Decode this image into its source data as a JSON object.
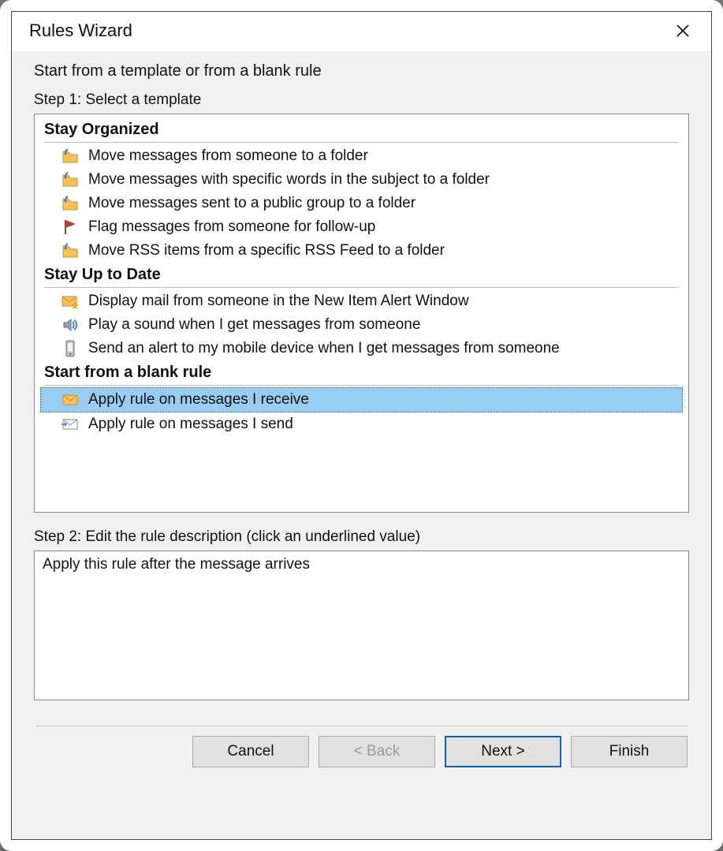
{
  "title": "Rules Wizard",
  "heading": "Start from a template or from a blank rule",
  "step1_label": "Step 1: Select a template",
  "groups": [
    {
      "title": "Stay Organized",
      "items": [
        {
          "icon": "folder-move",
          "label": "Move messages from someone to a folder",
          "selected": false
        },
        {
          "icon": "folder-move",
          "label": "Move messages with specific words in the subject to a folder",
          "selected": false
        },
        {
          "icon": "folder-move",
          "label": "Move messages sent to a public group to a folder",
          "selected": false
        },
        {
          "icon": "flag",
          "label": "Flag messages from someone for follow-up",
          "selected": false
        },
        {
          "icon": "folder-move",
          "label": "Move RSS items from a specific RSS Feed to a folder",
          "selected": false
        }
      ]
    },
    {
      "title": "Stay Up to Date",
      "items": [
        {
          "icon": "mail-star",
          "label": "Display mail from someone in the New Item Alert Window",
          "selected": false
        },
        {
          "icon": "speaker",
          "label": "Play a sound when I get messages from someone",
          "selected": false
        },
        {
          "icon": "mobile",
          "label": "Send an alert to my mobile device when I get messages from someone",
          "selected": false
        }
      ]
    },
    {
      "title": "Start from a blank rule",
      "items": [
        {
          "icon": "mail-in",
          "label": "Apply rule on messages I receive",
          "selected": true
        },
        {
          "icon": "mail-out",
          "label": "Apply rule on messages I send",
          "selected": false
        }
      ]
    }
  ],
  "step2_label": "Step 2: Edit the rule description (click an underlined value)",
  "description": "Apply this rule after the message arrives",
  "buttons": {
    "cancel": "Cancel",
    "back": "< Back",
    "next": "Next >",
    "finish": "Finish"
  }
}
